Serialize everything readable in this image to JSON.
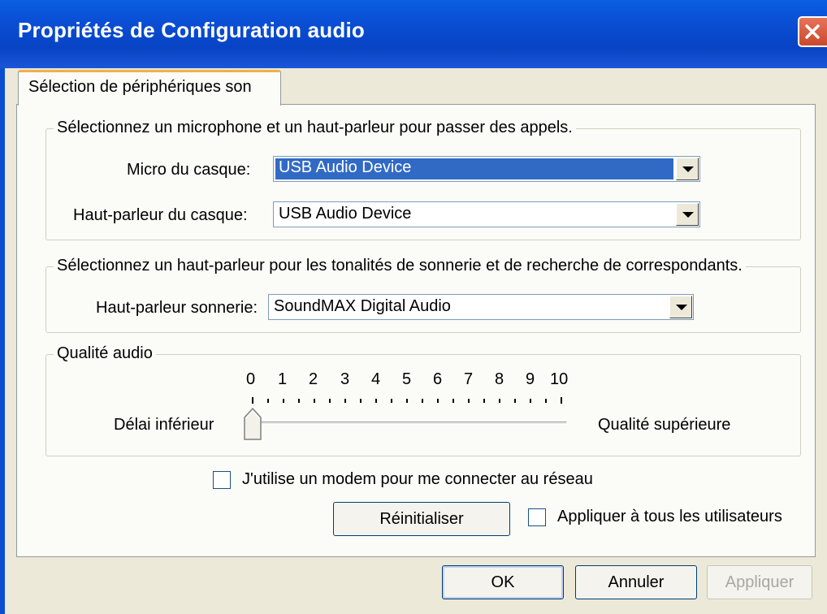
{
  "window": {
    "title": "Propriétés de Configuration audio"
  },
  "tabs": [
    {
      "label": "Sélection de périphériques son"
    }
  ],
  "calls_group": {
    "legend": "Sélectionnez un microphone et un haut-parleur pour passer des appels.",
    "mic_label": "Micro du casque:",
    "mic_value": "USB Audio Device",
    "speaker_label": "Haut-parleur du casque:",
    "speaker_value": "USB Audio Device"
  },
  "ring_group": {
    "legend": "Sélectionnez un haut-parleur pour les tonalités de sonnerie et de recherche de correspondants.",
    "ring_label": "Haut-parleur sonnerie:",
    "ring_value": "SoundMAX Digital Audio"
  },
  "quality_group": {
    "legend": "Qualité audio",
    "scale": [
      "0",
      "1",
      "2",
      "3",
      "4",
      "5",
      "6",
      "7",
      "8",
      "9",
      "10"
    ],
    "left_label": "Délai inférieur",
    "right_label": "Qualité supérieure",
    "slider_value": 0
  },
  "modem_checkbox": {
    "label": "J'utilise un modem pour me connecter au réseau",
    "checked": false
  },
  "reset_button": {
    "label": "Réinitialiser"
  },
  "apply_all_checkbox": {
    "label": "Appliquer à tous les utilisateurs",
    "checked": false
  },
  "buttons": {
    "ok": "OK",
    "cancel": "Annuler",
    "apply": "Appliquer"
  },
  "colors": {
    "titlebar": "#0a4fd6",
    "selection": "#316ac5",
    "close": "#d85a3c"
  }
}
